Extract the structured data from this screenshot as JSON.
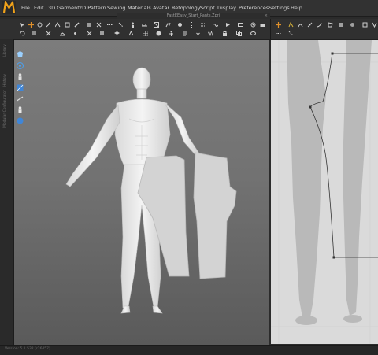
{
  "menu": {
    "items": [
      "File",
      "Edit",
      "3D Garment",
      "2D Pattern",
      "Sewing",
      "Materials",
      "Avatar",
      "Retopology",
      "Script",
      "Display",
      "Preferences",
      "Settings",
      "Help"
    ]
  },
  "file_tab": {
    "title": "FastEEasy_Start_Pants.Zprj",
    "close": "×"
  },
  "status": {
    "version": "Version: 5.1.532 (r26457)"
  },
  "colors": {
    "accent_logo": "#f0a21a",
    "viewport_bg": "#727272",
    "pattern_fill": "#d3d3d3",
    "pattern2d_bg": "#dadada"
  },
  "left_panel_labels": [
    "Library",
    "History",
    "Modular Configurator"
  ]
}
